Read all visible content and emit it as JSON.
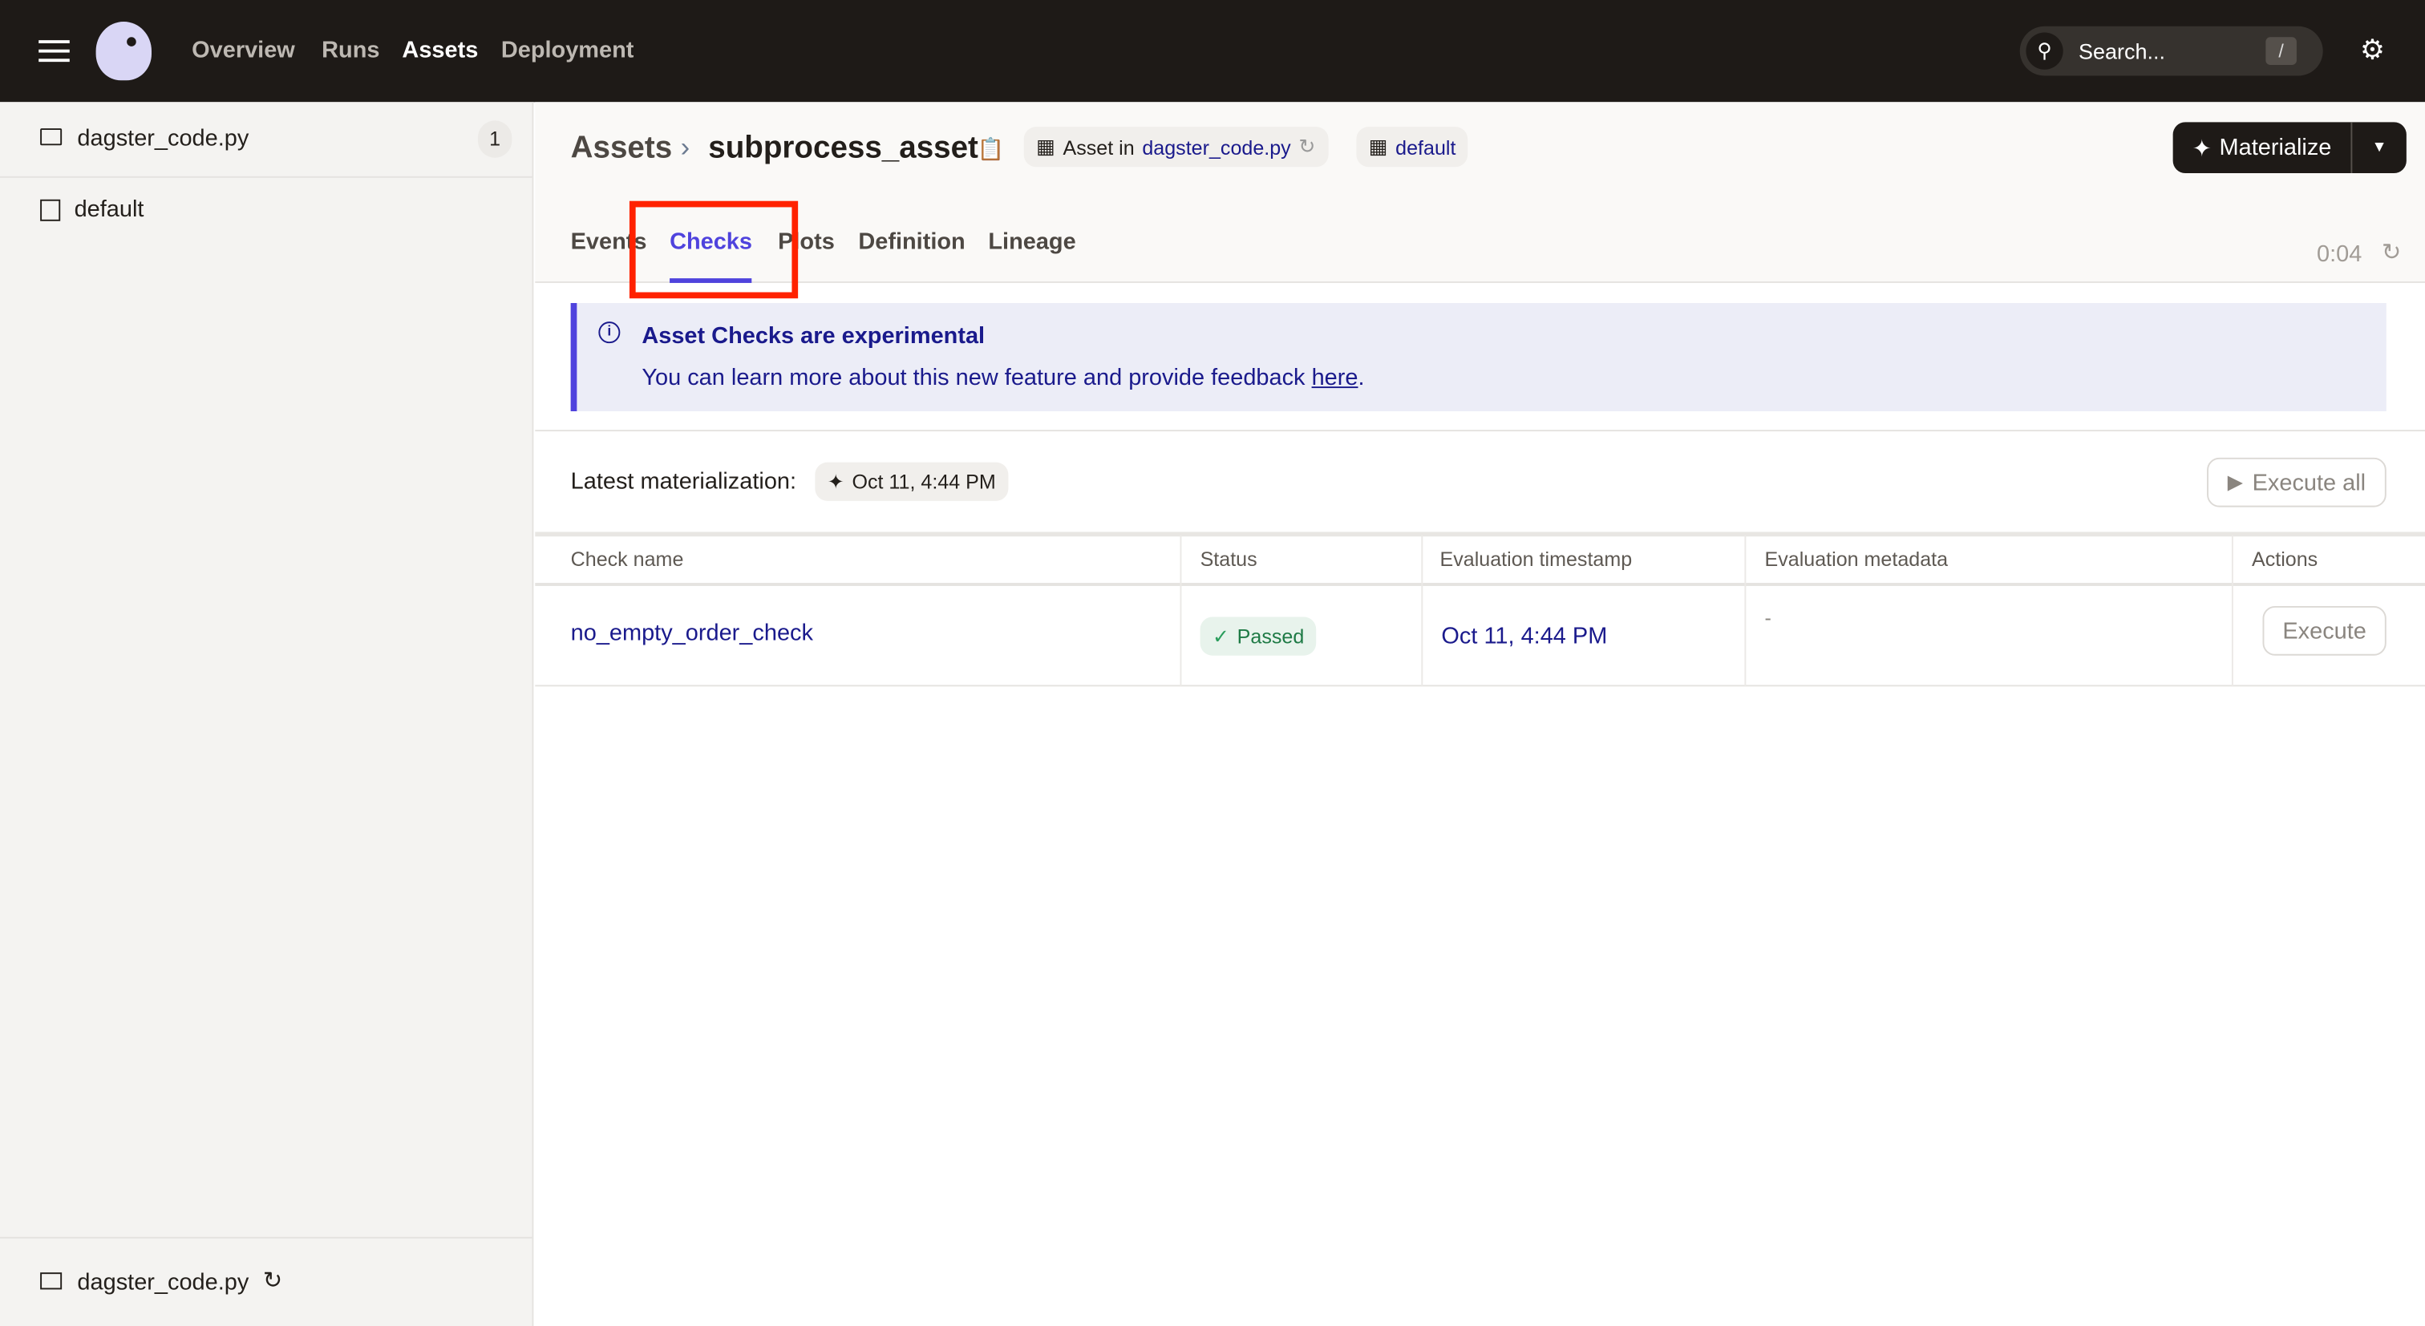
{
  "topbar": {
    "nav": [
      {
        "label": "Overview",
        "active": false
      },
      {
        "label": "Runs",
        "active": false
      },
      {
        "label": "Assets",
        "active": true
      },
      {
        "label": "Deployment",
        "active": false
      }
    ],
    "search_placeholder": "Search...",
    "search_shortcut": "/"
  },
  "sidebar": {
    "repo": "dagster_code.py",
    "repo_count": "1",
    "group": "default",
    "footer_repo": "dagster_code.py"
  },
  "header": {
    "breadcrumb_root": "Assets",
    "asset_name": "subprocess_asset",
    "asset_in_prefix": "Asset in",
    "asset_in_location": "dagster_code.py",
    "group": "default",
    "materialize_label": "Materialize"
  },
  "tabs": [
    {
      "label": "Events"
    },
    {
      "label": "Checks",
      "active": true
    },
    {
      "label": "Plots"
    },
    {
      "label": "Definition"
    },
    {
      "label": "Lineage"
    }
  ],
  "refresh_timer": "0:04",
  "banner": {
    "title": "Asset Checks are experimental",
    "text": "You can learn more about this new feature and provide feedback ",
    "link": "here",
    "suffix": "."
  },
  "latest": {
    "label": "Latest materialization:",
    "value": "Oct 11, 4:44 PM",
    "execute_all": "Execute all"
  },
  "table": {
    "headers": [
      "Check name",
      "Status",
      "Evaluation timestamp",
      "Evaluation metadata",
      "Actions"
    ],
    "rows": [
      {
        "name": "no_empty_order_check",
        "status": "Passed",
        "timestamp": "Oct 11, 4:44 PM",
        "metadata": "-",
        "action": "Execute"
      }
    ]
  },
  "colors": {
    "accent": "#4f43dd",
    "topbar": "#1e1a17",
    "highlight_box": "#ff2200",
    "passed": "#2a9d5c"
  }
}
